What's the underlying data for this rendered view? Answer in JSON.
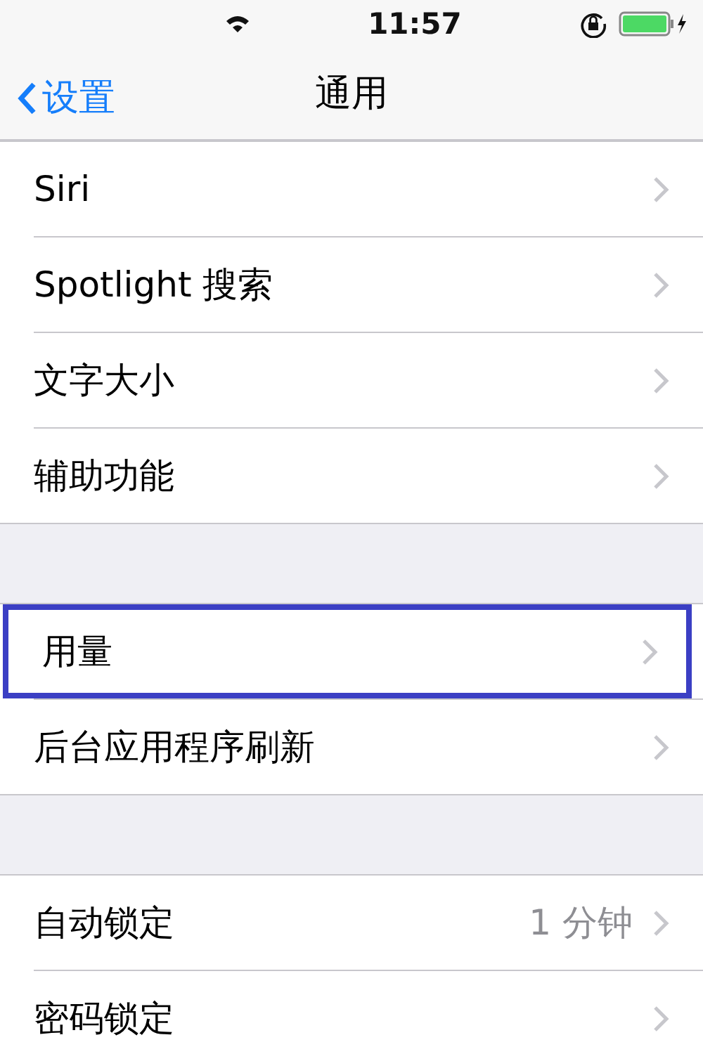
{
  "status_bar": {
    "time": "11:57"
  },
  "nav_bar": {
    "back": "设置",
    "title": "通用"
  },
  "groups": [
    {
      "rows": [
        {
          "label": "Siri",
          "highlighted": false
        },
        {
          "label": "Spotlight 搜索",
          "highlighted": false
        },
        {
          "label": "文字大小",
          "highlighted": false
        },
        {
          "label": "辅助功能",
          "highlighted": false
        }
      ]
    },
    {
      "rows": [
        {
          "label": "用量",
          "highlighted": true
        },
        {
          "label": "后台应用程序刷新",
          "highlighted": false
        }
      ]
    },
    {
      "rows": [
        {
          "label": "自动锁定",
          "value": "1 分钟",
          "highlighted": false
        },
        {
          "label": "密码锁定",
          "highlighted": false
        }
      ]
    }
  ]
}
